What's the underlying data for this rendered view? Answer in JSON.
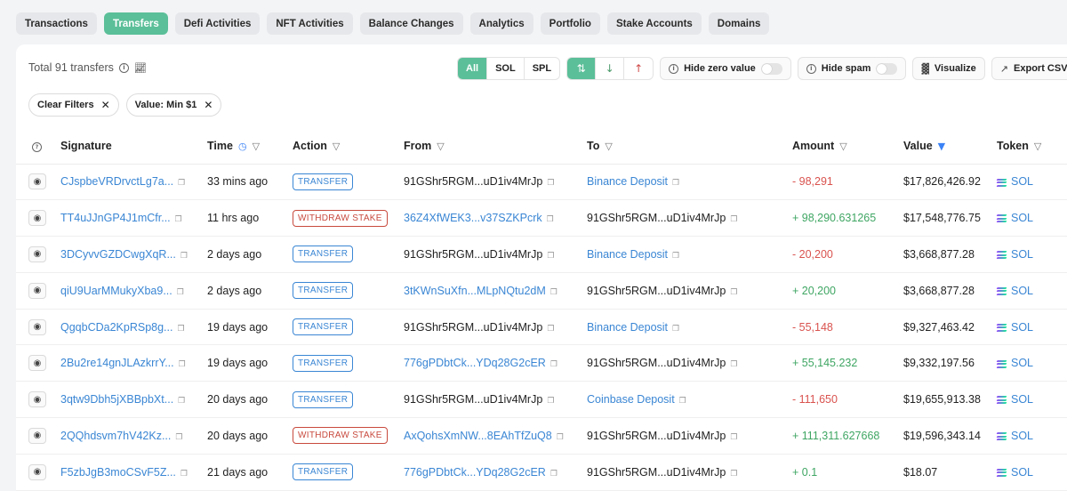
{
  "tabs": [
    {
      "label": "Transactions",
      "active": false
    },
    {
      "label": "Transfers",
      "active": true
    },
    {
      "label": "Defi Activities",
      "active": false
    },
    {
      "label": "NFT Activities",
      "active": false
    },
    {
      "label": "Balance Changes",
      "active": false
    },
    {
      "label": "Analytics",
      "active": false
    },
    {
      "label": "Portfolio",
      "active": false
    },
    {
      "label": "Stake Accounts",
      "active": false
    },
    {
      "label": "Domains",
      "active": false
    }
  ],
  "summary": {
    "total_label": "Total 91 transfers"
  },
  "toolbar": {
    "token_filter": [
      "All",
      "SOL",
      "SPL"
    ],
    "token_filter_active": "All",
    "hide_zero_label": "Hide zero value",
    "hide_spam_label": "Hide spam",
    "visualize_label": "Visualize",
    "export_label": "Export CSV"
  },
  "filters": {
    "clear_label": "Clear Filters",
    "value_chip_label": "Value:  Min $1"
  },
  "columns": {
    "signature": "Signature",
    "time": "Time",
    "action": "Action",
    "from": "From",
    "to": "To",
    "amount": "Amount",
    "value": "Value",
    "token": "Token"
  },
  "colors": {
    "accent": "#5bbf99",
    "link": "#3a86d4",
    "negative": "#d9534f",
    "positive": "#3fa663"
  },
  "rows": [
    {
      "signature": "CJspbeVRDrvctLg7a...",
      "time": "33 mins ago",
      "action": "TRANSFER",
      "from": "91GShr5RGM...uD1iv4MrJp",
      "from_link": false,
      "to": "Binance Deposit",
      "to_link": true,
      "amount": "- 98,291",
      "amount_sign": "neg",
      "value": "$17,826,426.92",
      "token": "SOL"
    },
    {
      "signature": "TT4uJJnGP4J1mCfr...",
      "time": "11 hrs ago",
      "action": "WITHDRAW STAKE",
      "from": "36Z4XfWEK3...v37SZKPcrk",
      "from_link": true,
      "to": "91GShr5RGM...uD1iv4MrJp",
      "to_link": false,
      "amount": "+ 98,290.631265",
      "amount_sign": "pos",
      "value": "$17,548,776.75",
      "token": "SOL"
    },
    {
      "signature": "3DCyvvGZDCwgXqR...",
      "time": "2 days ago",
      "action": "TRANSFER",
      "from": "91GShr5RGM...uD1iv4MrJp",
      "from_link": false,
      "to": "Binance Deposit",
      "to_link": true,
      "amount": "- 20,200",
      "amount_sign": "neg",
      "value": "$3,668,877.28",
      "token": "SOL"
    },
    {
      "signature": "qiU9UarMMukyXba9...",
      "time": "2 days ago",
      "action": "TRANSFER",
      "from": "3tKWnSuXfn...MLpNQtu2dM",
      "from_link": true,
      "to": "91GShr5RGM...uD1iv4MrJp",
      "to_link": false,
      "amount": "+ 20,200",
      "amount_sign": "pos",
      "value": "$3,668,877.28",
      "token": "SOL"
    },
    {
      "signature": "QgqbCDa2KpRSp8g...",
      "time": "19 days ago",
      "action": "TRANSFER",
      "from": "91GShr5RGM...uD1iv4MrJp",
      "from_link": false,
      "to": "Binance Deposit",
      "to_link": true,
      "amount": "- 55,148",
      "amount_sign": "neg",
      "value": "$9,327,463.42",
      "token": "SOL"
    },
    {
      "signature": "2Bu2re14gnJLAzkrrY...",
      "time": "19 days ago",
      "action": "TRANSFER",
      "from": "776gPDbtCk...YDq28G2cER",
      "from_link": true,
      "to": "91GShr5RGM...uD1iv4MrJp",
      "to_link": false,
      "amount": "+ 55,145.232",
      "amount_sign": "pos",
      "value": "$9,332,197.56",
      "token": "SOL"
    },
    {
      "signature": "3qtw9Dbh5jXBBpbXt...",
      "time": "20 days ago",
      "action": "TRANSFER",
      "from": "91GShr5RGM...uD1iv4MrJp",
      "from_link": false,
      "to": "Coinbase Deposit",
      "to_link": true,
      "amount": "- 111,650",
      "amount_sign": "neg",
      "value": "$19,655,913.38",
      "token": "SOL"
    },
    {
      "signature": "2QQhdsvm7hV42Kz...",
      "time": "20 days ago",
      "action": "WITHDRAW STAKE",
      "from": "AxQohsXmNW...8EAhTfZuQ8",
      "from_link": true,
      "to": "91GShr5RGM...uD1iv4MrJp",
      "to_link": false,
      "amount": "+ 111,311.627668",
      "amount_sign": "pos",
      "value": "$19,596,343.14",
      "token": "SOL"
    },
    {
      "signature": "F5zbJgB3moCSvF5Z...",
      "time": "21 days ago",
      "action": "TRANSFER",
      "from": "776gPDbtCk...YDq28G2cER",
      "from_link": true,
      "to": "91GShr5RGM...uD1iv4MrJp",
      "to_link": false,
      "amount": "+ 0.1",
      "amount_sign": "pos",
      "value": "$18.07",
      "token": "SOL"
    }
  ]
}
